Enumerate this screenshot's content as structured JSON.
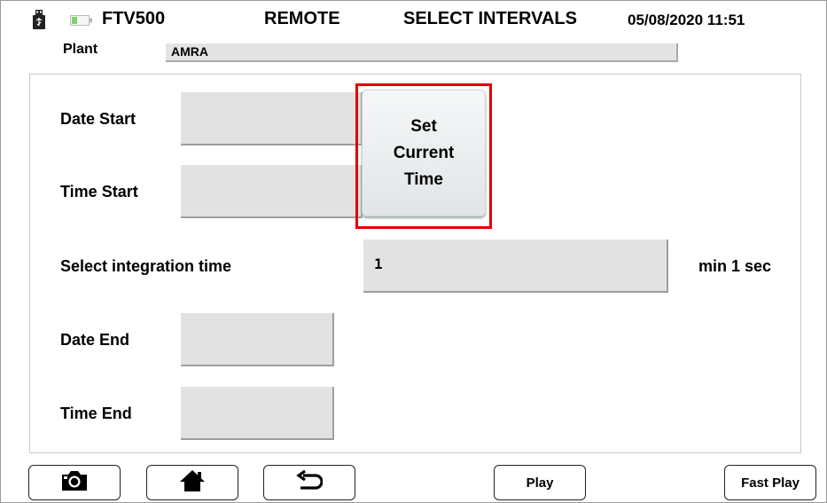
{
  "header": {
    "device": "FTV500",
    "mode": "REMOTE",
    "screen_title": "SELECT INTERVALS",
    "datetime": "05/08/2020 11:51",
    "usb_icon": "usb-drive-icon",
    "battery_icon": "battery-icon"
  },
  "plant": {
    "label": "Plant",
    "value": "AMRA"
  },
  "form": {
    "date_start_label": "Date Start",
    "date_start_value": "",
    "time_start_label": "Time Start",
    "time_start_value": "",
    "set_current_time_lines": [
      "Set",
      "Current",
      "Time"
    ],
    "integration_label": "Select integration time",
    "integration_value": "1",
    "integration_unit": "min 1 sec",
    "date_end_label": "Date End",
    "date_end_value": "",
    "time_end_label": "Time End",
    "time_end_value": ""
  },
  "toolbar": {
    "camera_icon": "camera-icon",
    "home_icon": "home-icon",
    "back_icon": "back-arrow-icon",
    "play_label": "Play",
    "fast_play_label": "Fast Play"
  },
  "colors": {
    "highlight": "#e00000",
    "field_bg": "#e2e2e2"
  }
}
